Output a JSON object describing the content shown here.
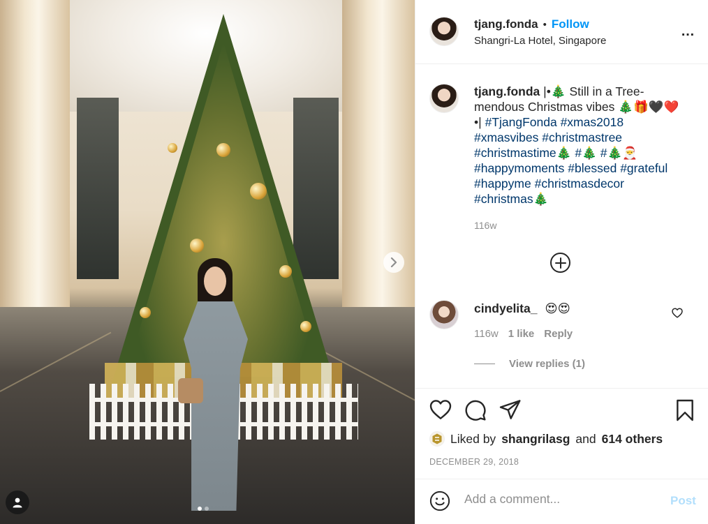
{
  "post": {
    "username": "tjang.fonda",
    "separator": "•",
    "follow_label": "Follow",
    "location": "Shangri-La Hotel, Singapore",
    "more_icon": "…"
  },
  "caption": {
    "username": "tjang.fonda",
    "text_part1": "|•🎄 Still in a Tree-mendous Christmas vibes 🎄🎁🖤❤️ •|",
    "hashtags_line1": [
      "#TjangFonda",
      "#xmas2018"
    ],
    "hashtags_line2": [
      "#xmasvibes",
      "#christmastree"
    ],
    "hashtags_line3_a": "#christmastime🎄",
    "hashtags_line3_b": "#🎄",
    "hashtags_line3_c": "#🎄🎅",
    "hashtags_line4": [
      "#happymoments",
      "#blessed",
      "#grateful"
    ],
    "hashtags_line5": [
      "#happyme",
      "#christmasdecor"
    ],
    "hashtags_line6": "#christmas🎄",
    "timestamp": "116w"
  },
  "comment": {
    "username": "cindyelita_",
    "text": "😍😍",
    "timestamp": "116w",
    "likes": "1 like",
    "reply_label": "Reply",
    "view_replies": "View replies (1)"
  },
  "likes": {
    "prefix": "Liked by",
    "user": "shangrilasg",
    "and": "and",
    "others": "614 others"
  },
  "date": "DECEMBER 29, 2018",
  "add_comment": {
    "placeholder": "Add a comment...",
    "post_label": "Post"
  },
  "colors": {
    "accent": "#0095f6",
    "hashtag": "#00376b",
    "muted": "#8e8e8e",
    "post_disabled": "#b2dffc"
  },
  "carousel": {
    "slides": 2,
    "active_slide": 1
  }
}
